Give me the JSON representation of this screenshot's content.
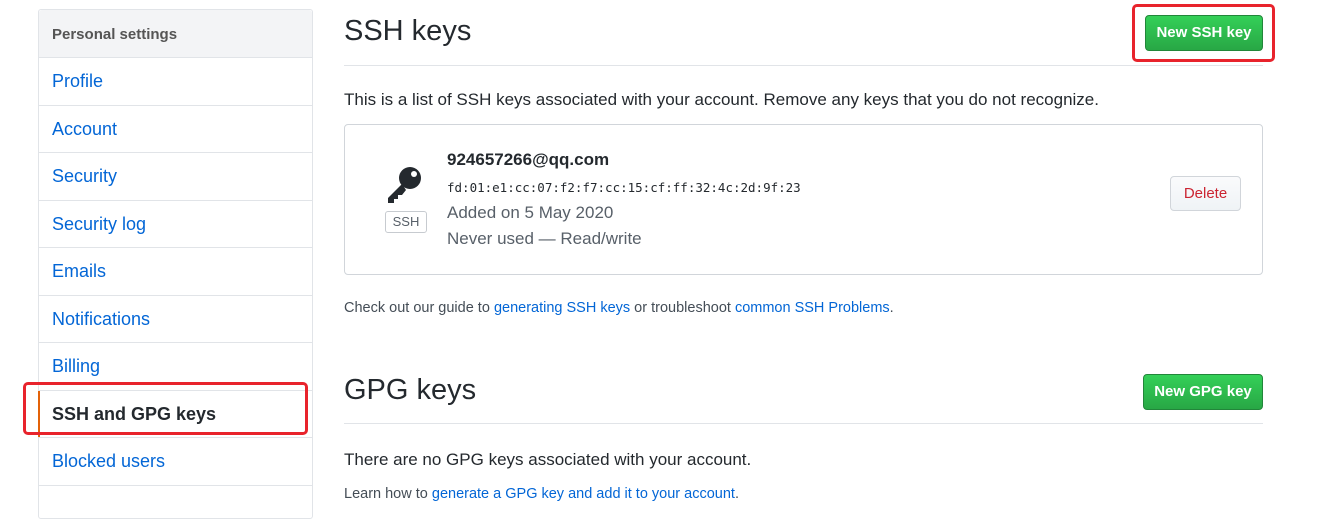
{
  "sidebar": {
    "header": "Personal settings",
    "items": [
      {
        "label": "Profile"
      },
      {
        "label": "Account"
      },
      {
        "label": "Security"
      },
      {
        "label": "Security log"
      },
      {
        "label": "Emails"
      },
      {
        "label": "Notifications"
      },
      {
        "label": "Billing"
      },
      {
        "label": "SSH and GPG keys"
      },
      {
        "label": "Blocked users"
      }
    ],
    "selected_index": 7
  },
  "ssh": {
    "title": "SSH keys",
    "new_button": "New SSH key",
    "intro": "This is a list of SSH keys associated with your account. Remove any keys that you do not recognize.",
    "keys": [
      {
        "title": "924657266@qq.com",
        "fingerprint": "fd:01:e1:cc:07:f2:f7:cc:15:cf:ff:32:4c:2d:9f:23",
        "badge": "SSH",
        "added": "Added on 5 May 2020",
        "usage": "Never used — Read/write",
        "delete_label": "Delete"
      }
    ],
    "guide": {
      "prefix": "Check out our guide to ",
      "link1": "generating SSH keys",
      "middle": " or troubleshoot ",
      "link2": "common SSH Problems",
      "suffix": "."
    }
  },
  "gpg": {
    "title": "GPG keys",
    "new_button": "New GPG key",
    "empty_text": "There are no GPG keys associated with your account.",
    "learn": {
      "prefix": "Learn how to ",
      "link": "generate a GPG key and add it to your account",
      "suffix": "."
    }
  },
  "colors": {
    "link": "#0366d6",
    "primary_button": "#28a745",
    "danger": "#cb2431",
    "annotation": "#e8232c"
  }
}
